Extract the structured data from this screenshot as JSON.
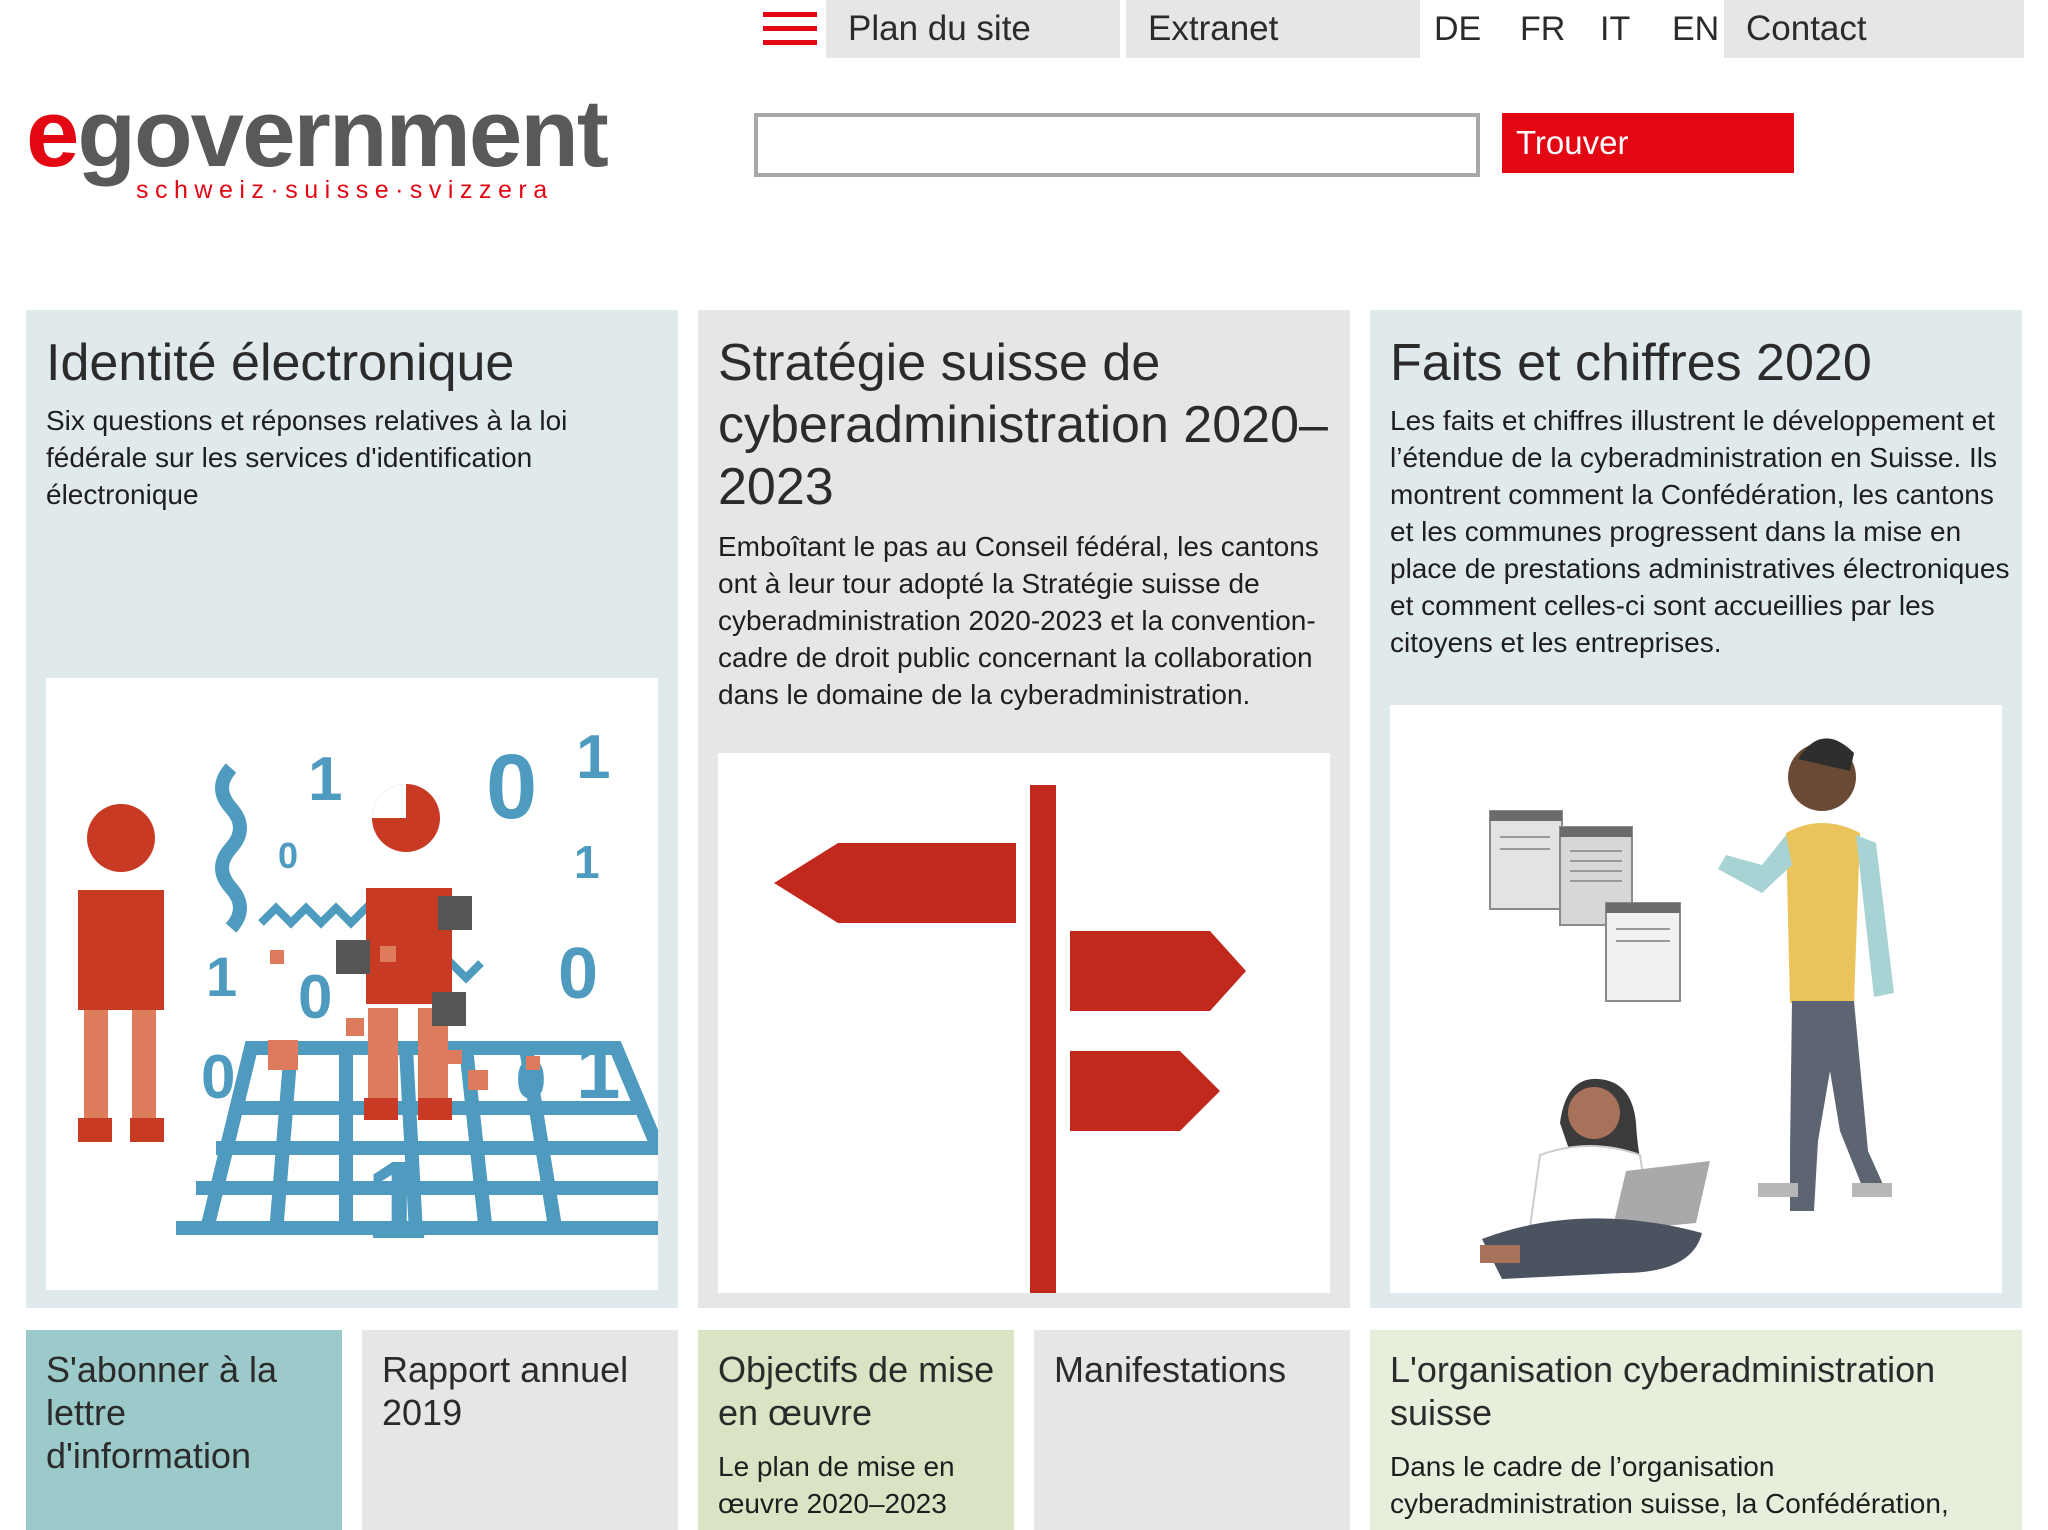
{
  "header": {
    "menu_icon": "hamburger-menu-icon",
    "sitemap_label": "Plan du site",
    "extranet_label": "Extranet",
    "languages": [
      "DE",
      "FR",
      "IT",
      "EN"
    ],
    "contact_label": "Contact"
  },
  "logo": {
    "main_e": "e",
    "main_rest": "government",
    "subtitle": "schweiz·suisse·svizzera"
  },
  "search": {
    "value": "",
    "placeholder": "",
    "button_label": "Trouver"
  },
  "colors": {
    "brand_red": "#e30613",
    "card_blue": "#e0eaed",
    "card_grey": "#e6e6e6",
    "tile_teal": "#9ccacb",
    "tile_green": "#d8e4c3",
    "tile_light_green": "#e7efdc"
  },
  "cards": [
    {
      "title": "Identité électronique",
      "text": "Six questions et réponses relatives à la loi fédérale sur les services d'identification électronique",
      "image_icon": "digital-identity-illustration"
    },
    {
      "title": "Stratégie suisse de cyberadministration 2020–2023",
      "text": "Emboîtant le pas au Conseil fédéral, les cantons ont à leur tour adopté la Stratégie suisse de cyberadministration 2020-2023 et la convention-cadre de droit public concernant la collaboration dans le domaine de la cyberadministration.",
      "image_icon": "signpost-illustration"
    },
    {
      "title": "Faits et chiffres 2020",
      "text": "Les faits et chiffres illustrent le développement et l’étendue de la cyberadministration en Suisse. Ils montrent comment la Confédération, les cantons et les communes progressent dans la mise en place de prestations administratives électroniques et comment celles-ci sont accueillies par les citoyens et les entreprises.",
      "image_icon": "people-with-documents-illustration"
    }
  ],
  "tiles": [
    {
      "title": "S'abonner à la lettre d'information",
      "text": ""
    },
    {
      "title": "Rapport annuel 2019",
      "text": ""
    },
    {
      "title": "Objectifs de mise en œuvre",
      "text": "Le plan de mise en œuvre 2020–2023"
    },
    {
      "title": "Manifestations",
      "text": ""
    },
    {
      "title": "L'organisation cyberadministration suisse",
      "text": "Dans le cadre de l’organisation cyberadministration suisse, la Confédération,"
    }
  ]
}
